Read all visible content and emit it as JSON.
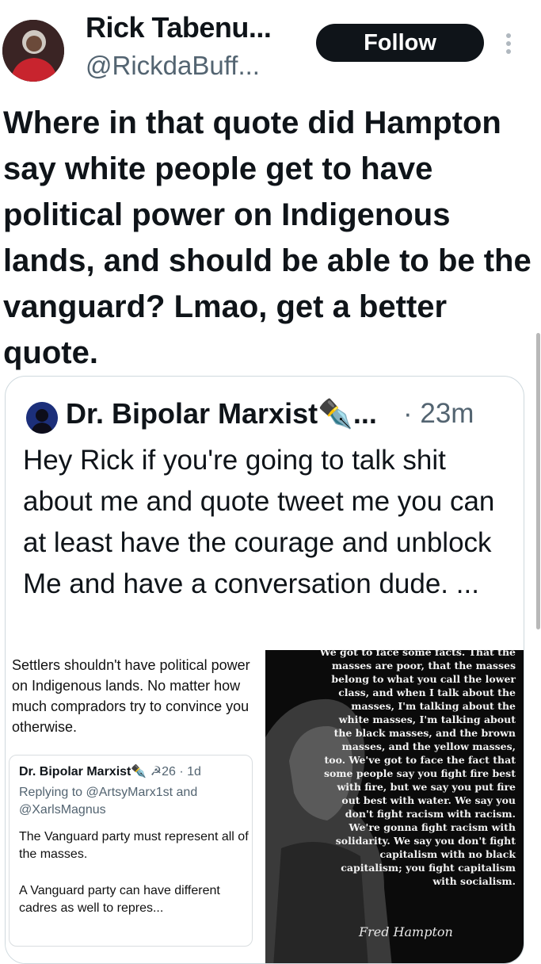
{
  "header": {
    "display_name": "Rick Tabenu...",
    "handle": "@RickdaBuff...",
    "follow_label": "Follow",
    "more_icon": "more-vertical-icon"
  },
  "tweet": {
    "text": "Where in that quote did Hampton say white people get to have political power on Indigenous lands, and should be able to be the vanguard? Lmao, get a better quote."
  },
  "quoted_tweet": {
    "author": "Dr. Bipolar Marxist✒️...",
    "time": "· 23m",
    "text": "Hey Rick if you're going to talk shit about me and quote tweet me you can at least have the courage and unblock Me and have a conversation dude. ...",
    "media": {
      "left_screenshot": {
        "text": "Settlers shouldn't have political power on Indigenous lands. No matter how much compradors try to convince you otherwise.",
        "inner_name": "Dr. Bipolar Marxist✒️",
        "inner_suffix": "☭26 · 1d",
        "replying_to": "Replying to @ArtsyMarx1st and @XarlsMagnus",
        "body1": "The Vanguard party must represent all of the masses.",
        "body2": "A Vanguard party can have different cadres as well to repres..."
      },
      "right_image": {
        "quote": "We got to face some facts. That the masses are poor, that the masses belong to what you call the lower class, and when I talk about the masses, I'm talking about the white masses, I'm talking about the black masses, and the brown masses, and the yellow masses, too. We've got to face the fact that some people say you fight fire best with fire, but we say you put fire out best with water. We say you don't fight racism with racism. We're gonna fight racism with solidarity. We say you don't fight capitalism with no black capitalism; you fight capitalism with socialism.",
        "signature": "Fred Hampton"
      }
    }
  },
  "colors": {
    "text": "#0f1419",
    "secondary": "#536471",
    "follow_bg": "#0f1419",
    "border": "#cfd9de"
  }
}
